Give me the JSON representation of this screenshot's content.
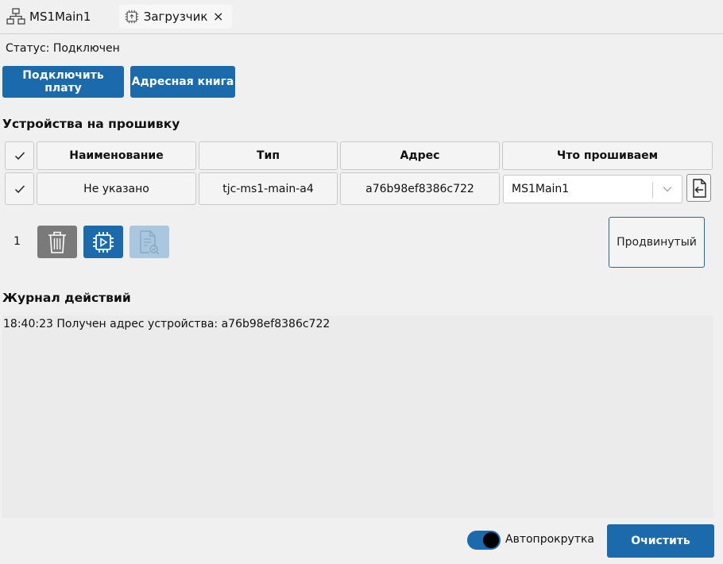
{
  "tabs": [
    {
      "label": "MS1Main1",
      "icon": "network-icon"
    },
    {
      "label": "Загрузчик",
      "icon": "chip-upload-icon",
      "closable": true
    }
  ],
  "status": "Статус: Подключен",
  "buttons": {
    "connect": "Подключить плату",
    "address_book": "Адресная книга",
    "advanced": "Продвинутый",
    "clear": "Очистить"
  },
  "devices": {
    "title": "Устройства на прошивку",
    "columns": [
      "Наименование",
      "Тип",
      "Адрес",
      "Что прошиваем"
    ],
    "rows": [
      {
        "checked": true,
        "name": "Не указано",
        "type": "tjc-ms1-main-a4",
        "address": "a76b98ef8386c722",
        "target": "MS1Main1"
      }
    ],
    "count": "1"
  },
  "log": {
    "title": "Журнал действий",
    "lines": [
      "18:40:23 Получен адрес устройства: a76b98ef8386c722"
    ]
  },
  "autoscroll": {
    "label": "Автопрокрутка",
    "enabled": true
  },
  "colors": {
    "accent": "#1b6aab",
    "disabled_accent": "#a9c8e0",
    "trash_gray": "#7a7a7a"
  }
}
